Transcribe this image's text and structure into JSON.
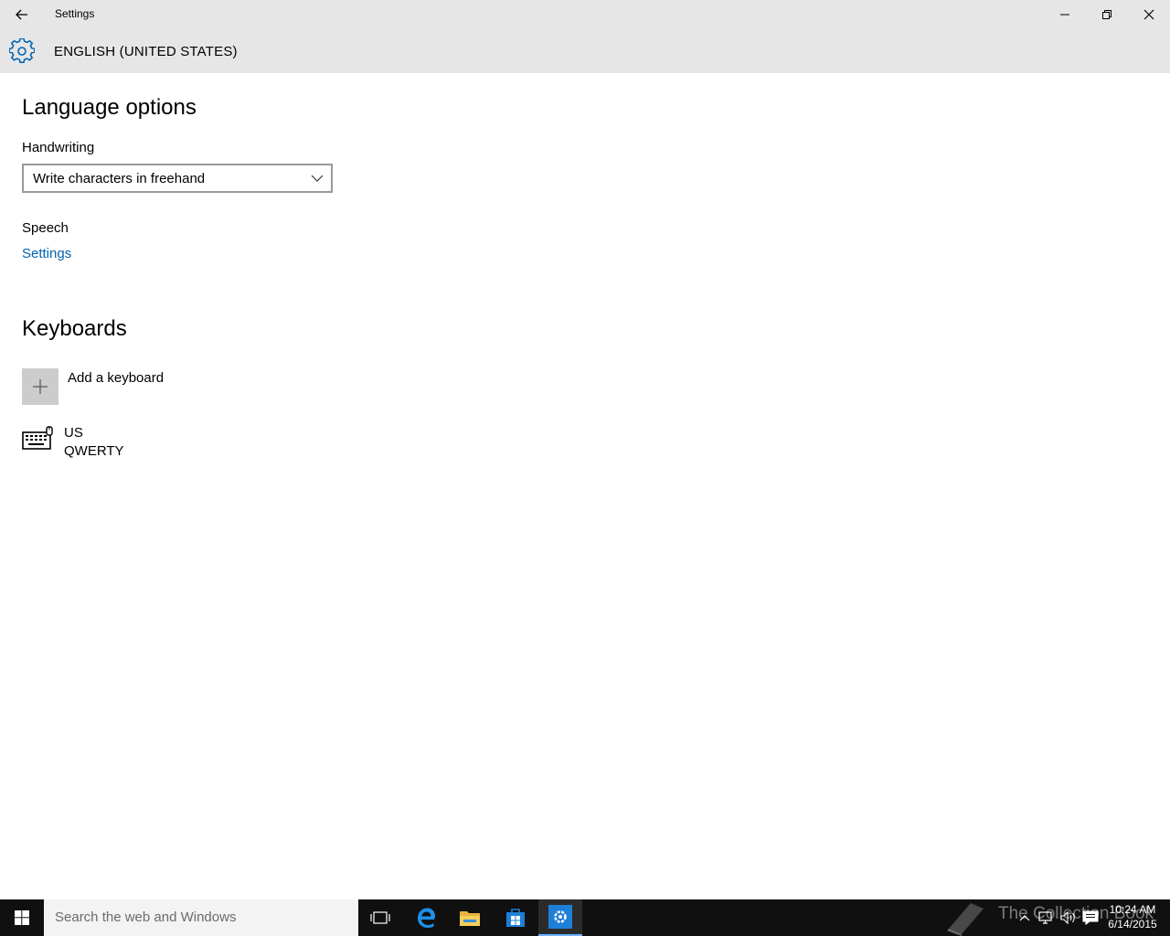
{
  "window": {
    "title": "Settings",
    "back_icon": "back-arrow-icon",
    "controls": [
      "minimize",
      "restore",
      "close"
    ]
  },
  "header": {
    "icon": "gear-icon",
    "title": "ENGLISH (UNITED STATES)",
    "accent_color": "#0063b1"
  },
  "language_options": {
    "title": "Language options",
    "handwriting": {
      "label": "Handwriting",
      "selected": "Write characters in freehand"
    },
    "speech": {
      "label": "Speech",
      "link": "Settings"
    }
  },
  "keyboards": {
    "title": "Keyboards",
    "add_label": "Add a keyboard",
    "items": [
      {
        "name": "US",
        "layout": "QWERTY",
        "icon": "keyboard-icon"
      }
    ]
  },
  "taskbar": {
    "search_placeholder": "Search the web and Windows",
    "pinned": [
      "task-view-icon",
      "edge-icon",
      "file-explorer-icon",
      "store-icon",
      "settings-icon"
    ],
    "active_app": "settings-icon",
    "clock": {
      "time": "10:24 AM",
      "date": "6/14/2015"
    },
    "tray": [
      "chevron-up-icon",
      "network-icon",
      "volume-icon",
      "action-center-icon"
    ],
    "watermark": "The Collection Book"
  }
}
